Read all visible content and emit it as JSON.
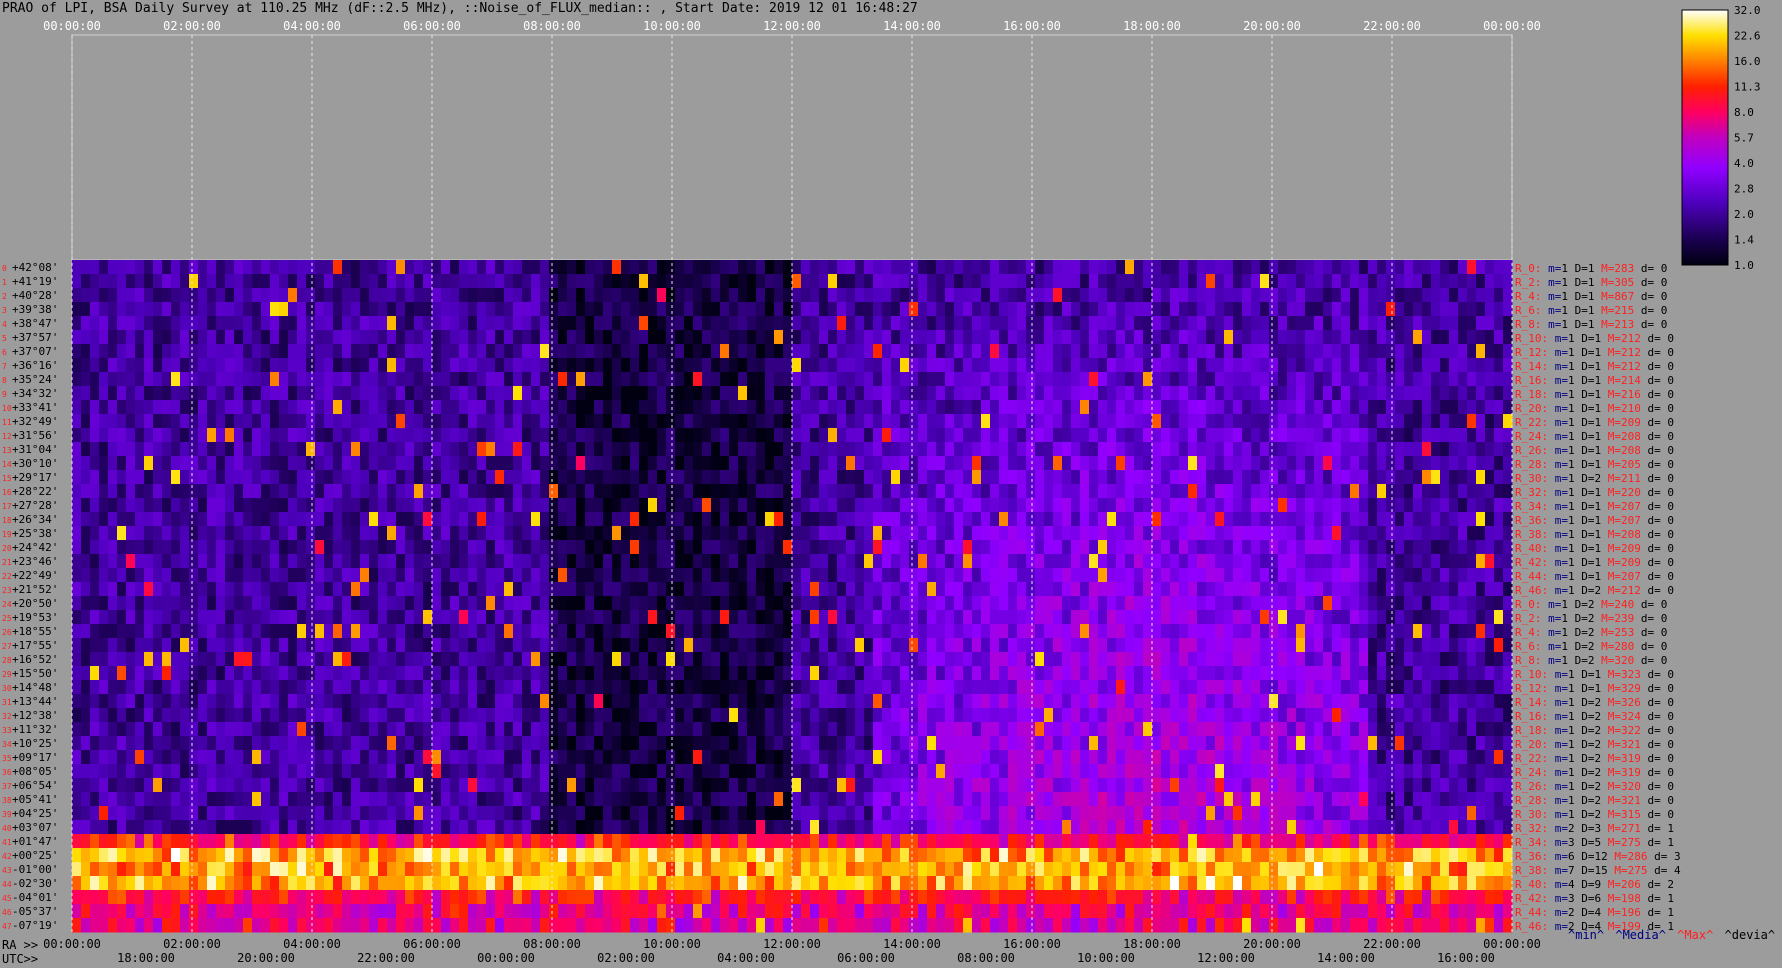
{
  "title": "PRAO of LPI, BSA Daily Survey at 110.25 MHz (dF::2.5 MHz), ::Noise_of_FLUX_median:: , Start Date: 2019 12 01 16:48:27",
  "footer": {
    "ra_label": "RA >>",
    "utc_label": "UTC>>"
  },
  "stats_legend": {
    "min": "^min^",
    "median": "^Media^",
    "max": "^Max^",
    "devia": "^devia^"
  },
  "colors": {
    "background": "#9c9c9c",
    "low": "#000020",
    "mid": "#8000ff",
    "high": "#ff0000",
    "peak": "#ffffff"
  },
  "chart_data": {
    "type": "heatmap",
    "title": "PRAO of LPI, BSA Daily Survey at 110.25 MHz (dF::2.5 MHz), ::Noise_of_FLUX_median:: , Start Date: 2019 12 01 16:48:27",
    "top_axis_ticks": [
      "00:00:00",
      "02:00:00",
      "04:00:00",
      "06:00:00",
      "08:00:00",
      "10:00:00",
      "12:00:00",
      "14:00:00",
      "16:00:00",
      "18:00:00",
      "20:00:00",
      "22:00:00",
      "00:00:00"
    ],
    "ra_axis_ticks": [
      "00:00:00",
      "02:00:00",
      "04:00:00",
      "06:00:00",
      "08:00:00",
      "10:00:00",
      "12:00:00",
      "14:00:00",
      "16:00:00",
      "18:00:00",
      "20:00:00",
      "22:00:00",
      "00:00:00"
    ],
    "utc_axis_ticks": [
      "18:00:00",
      "20:00:00",
      "22:00:00",
      "00:00:00",
      "02:00:00",
      "04:00:00",
      "06:00:00",
      "08:00:00",
      "10:00:00",
      "12:00:00",
      "14:00:00",
      "16:00:00"
    ],
    "declinations": [
      "+42°08'",
      "+41°19'",
      "+40°28'",
      "+39°38'",
      "+38°47'",
      "+37°57'",
      "+37°07'",
      "+36°16'",
      "+35°24'",
      "+34°32'",
      "+33°41'",
      "+32°49'",
      "+31°56'",
      "+31°04'",
      "+30°10'",
      "+29°17'",
      "+28°22'",
      "+27°28'",
      "+26°34'",
      "+25°38'",
      "+24°42'",
      "+23°46'",
      "+22°49'",
      "+21°52'",
      "+20°50'",
      "+19°53'",
      "+18°55'",
      "+17°55'",
      "+16°52'",
      "+15°50'",
      "+14°48'",
      "+13°44'",
      "+12°38'",
      "+11°32'",
      "+10°25'",
      "+09°17'",
      "+08°05'",
      "+06°54'",
      "+05°41'",
      "+04°25'",
      "+03°07'",
      "+01°47'",
      "+00°25'",
      "-01°00'",
      "-02°30'",
      "-04°01'",
      "-05°37'",
      "-07°19'"
    ],
    "colorbar": {
      "ticks": [
        "32.0",
        "22.6",
        "16.0",
        "11.3",
        "8.0",
        "5.7",
        "4.0",
        "2.8",
        "2.0",
        "1.4",
        "1.0"
      ],
      "range": [
        1.0,
        32.0
      ],
      "scale": "log"
    },
    "beam_stats": [
      {
        "label": "R_0:",
        "min": "1",
        "D": "1",
        "M": "283",
        "d": "0"
      },
      {
        "label": "R_2:",
        "min": "1",
        "D": "1",
        "M": "305",
        "d": "0"
      },
      {
        "label": "R_4:",
        "min": "1",
        "D": "1",
        "M": "867",
        "d": "0"
      },
      {
        "label": "R_6:",
        "min": "1",
        "D": "1",
        "M": "215",
        "d": "0"
      },
      {
        "label": "R_8:",
        "min": "1",
        "D": "1",
        "M": "213",
        "d": "0"
      },
      {
        "label": "R_10:",
        "min": "1",
        "D": "1",
        "M": "212",
        "d": "0"
      },
      {
        "label": "R_12:",
        "min": "1",
        "D": "1",
        "M": "212",
        "d": "0"
      },
      {
        "label": "R_14:",
        "min": "1",
        "D": "1",
        "M": "212",
        "d": "0"
      },
      {
        "label": "R_16:",
        "min": "1",
        "D": "1",
        "M": "214",
        "d": "0"
      },
      {
        "label": "R_18:",
        "min": "1",
        "D": "1",
        "M": "216",
        "d": "0"
      },
      {
        "label": "R_20:",
        "min": "1",
        "D": "1",
        "M": "210",
        "d": "0"
      },
      {
        "label": "R_22:",
        "min": "1",
        "D": "1",
        "M": "209",
        "d": "0"
      },
      {
        "label": "R_24:",
        "min": "1",
        "D": "1",
        "M": "208",
        "d": "0"
      },
      {
        "label": "R_26:",
        "min": "1",
        "D": "1",
        "M": "208",
        "d": "0"
      },
      {
        "label": "R_28:",
        "min": "1",
        "D": "1",
        "M": "205",
        "d": "0"
      },
      {
        "label": "R_30:",
        "min": "1",
        "D": "2",
        "M": "211",
        "d": "0"
      },
      {
        "label": "R_32:",
        "min": "1",
        "D": "1",
        "M": "220",
        "d": "0"
      },
      {
        "label": "R_34:",
        "min": "1",
        "D": "1",
        "M": "207",
        "d": "0"
      },
      {
        "label": "R_36:",
        "min": "1",
        "D": "1",
        "M": "207",
        "d": "0"
      },
      {
        "label": "R_38:",
        "min": "1",
        "D": "1",
        "M": "208",
        "d": "0"
      },
      {
        "label": "R_40:",
        "min": "1",
        "D": "1",
        "M": "209",
        "d": "0"
      },
      {
        "label": "R_42:",
        "min": "1",
        "D": "1",
        "M": "209",
        "d": "0"
      },
      {
        "label": "R_44:",
        "min": "1",
        "D": "1",
        "M": "207",
        "d": "0"
      },
      {
        "label": "R_46:",
        "min": "1",
        "D": "2",
        "M": "212",
        "d": "0"
      },
      {
        "label": "R_0:",
        "min": "1",
        "D": "2",
        "M": "240",
        "d": "0"
      },
      {
        "label": "R_2:",
        "min": "1",
        "D": "2",
        "M": "239",
        "d": "0"
      },
      {
        "label": "R_4:",
        "min": "1",
        "D": "2",
        "M": "253",
        "d": "0"
      },
      {
        "label": "R_6:",
        "min": "1",
        "D": "2",
        "M": "280",
        "d": "0"
      },
      {
        "label": "R_8:",
        "min": "1",
        "D": "2",
        "M": "320",
        "d": "0"
      },
      {
        "label": "R_10:",
        "min": "1",
        "D": "1",
        "M": "323",
        "d": "0"
      },
      {
        "label": "R_12:",
        "min": "1",
        "D": "1",
        "M": "329",
        "d": "0"
      },
      {
        "label": "R_14:",
        "min": "1",
        "D": "2",
        "M": "326",
        "d": "0"
      },
      {
        "label": "R_16:",
        "min": "1",
        "D": "2",
        "M": "324",
        "d": "0"
      },
      {
        "label": "R_18:",
        "min": "1",
        "D": "2",
        "M": "322",
        "d": "0"
      },
      {
        "label": "R_20:",
        "min": "1",
        "D": "2",
        "M": "321",
        "d": "0"
      },
      {
        "label": "R_22:",
        "min": "1",
        "D": "2",
        "M": "319",
        "d": "0"
      },
      {
        "label": "R_24:",
        "min": "1",
        "D": "2",
        "M": "319",
        "d": "0"
      },
      {
        "label": "R_26:",
        "min": "1",
        "D": "2",
        "M": "320",
        "d": "0"
      },
      {
        "label": "R_28:",
        "min": "1",
        "D": "2",
        "M": "321",
        "d": "0"
      },
      {
        "label": "R_30:",
        "min": "1",
        "D": "2",
        "M": "315",
        "d": "0"
      },
      {
        "label": "R_32:",
        "min": "2",
        "D": "3",
        "M": "271",
        "d": "1"
      },
      {
        "label": "R_34:",
        "min": "3",
        "D": "5",
        "M": "275",
        "d": "1"
      },
      {
        "label": "R_36:",
        "min": "6",
        "D": "12",
        "M": "286",
        "d": "3"
      },
      {
        "label": "R_38:",
        "min": "7",
        "D": "15",
        "M": "275",
        "d": "4"
      },
      {
        "label": "R_40:",
        "min": "4",
        "D": "9",
        "M": "206",
        "d": "2"
      },
      {
        "label": "R_42:",
        "min": "3",
        "D": "6",
        "M": "198",
        "d": "1"
      },
      {
        "label": "R_44:",
        "min": "2",
        "D": "4",
        "M": "196",
        "d": "1"
      },
      {
        "label": "R_46:",
        "min": "2",
        "D": "4",
        "M": "199",
        "d": "1"
      }
    ]
  }
}
